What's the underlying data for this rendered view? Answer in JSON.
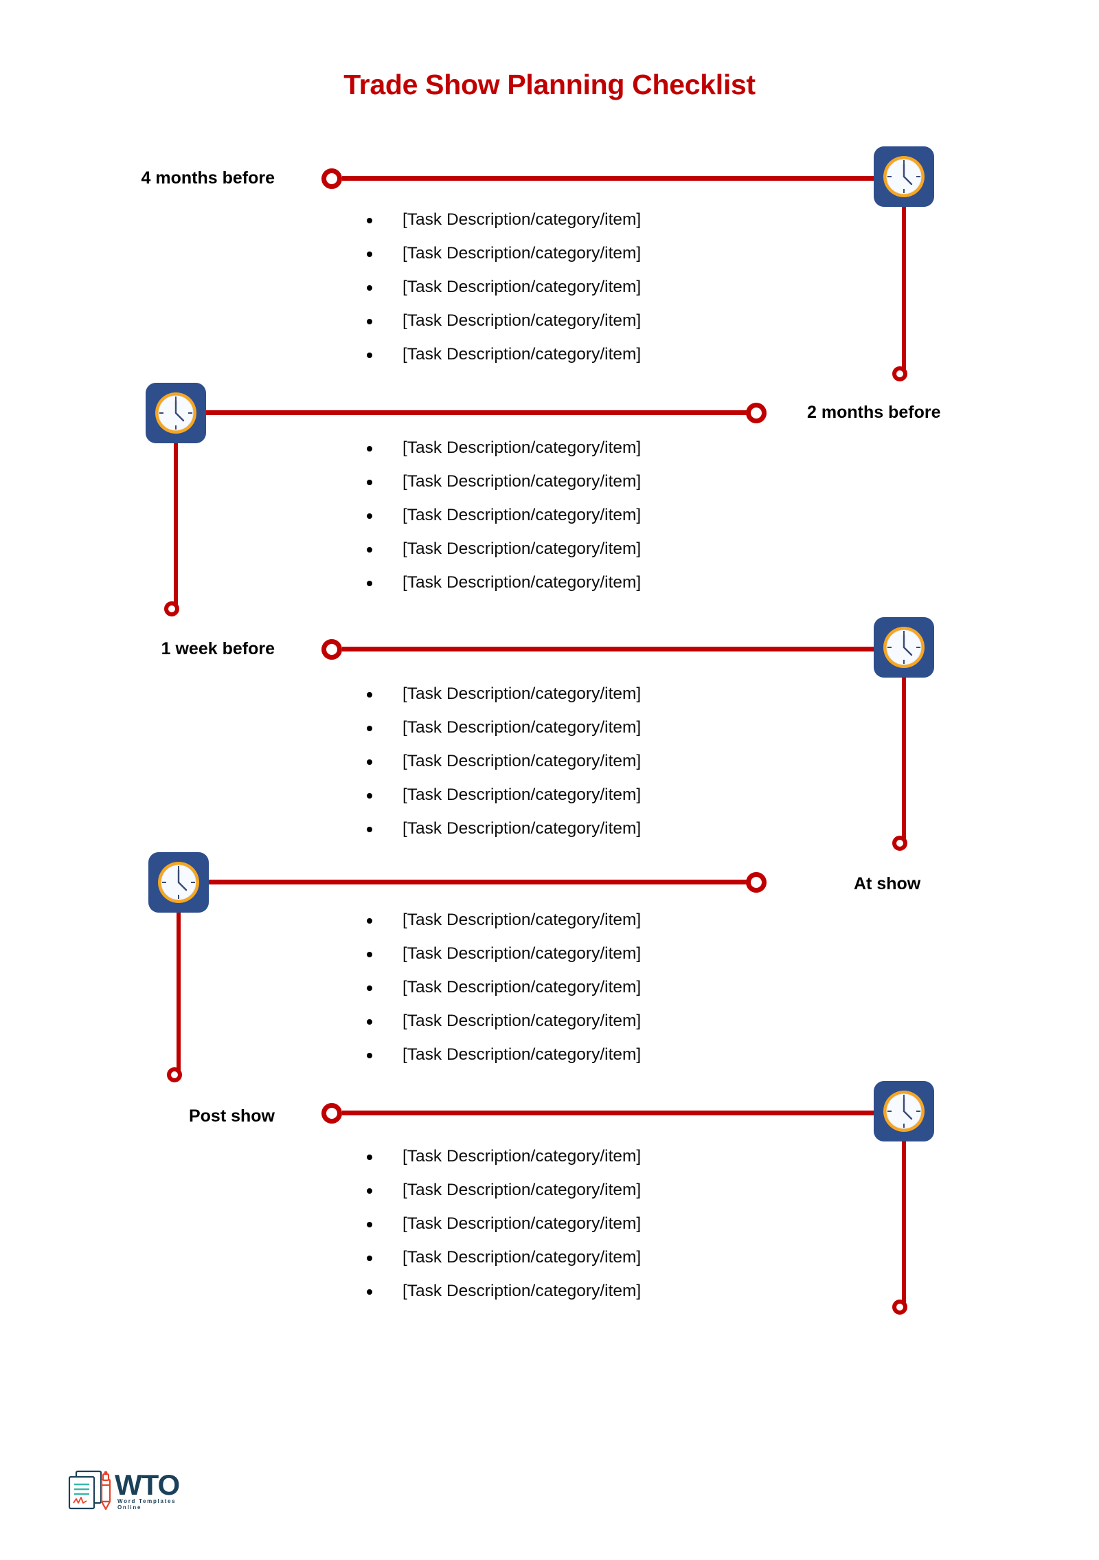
{
  "document": {
    "title": "Trade Show Planning Checklist",
    "title_color": "#C00000",
    "accent_color": "#C00000",
    "icon_box_color": "#2F4E8C",
    "icon_bezel_color": "#F5A623",
    "background": "#FFFFFF"
  },
  "timeline": {
    "sections": [
      {
        "label": "4 months before",
        "label_side": "left",
        "icon_side": "right",
        "icon": "clock-icon",
        "tasks": [
          "[Task Description/category/item]",
          "[Task Description/category/item]",
          "[Task Description/category/item]",
          "[Task Description/category/item]",
          "[Task Description/category/item]"
        ]
      },
      {
        "label": "2 months before",
        "label_side": "right",
        "icon_side": "left",
        "icon": "clock-icon",
        "tasks": [
          "[Task Description/category/item]",
          "[Task Description/category/item]",
          "[Task Description/category/item]",
          "[Task Description/category/item]",
          "[Task Description/category/item]"
        ]
      },
      {
        "label": "1 week before",
        "label_side": "left",
        "icon_side": "right",
        "icon": "clock-icon",
        "tasks": [
          "[Task Description/category/item]",
          "[Task Description/category/item]",
          "[Task Description/category/item]",
          "[Task Description/category/item]",
          "[Task Description/category/item]"
        ]
      },
      {
        "label": "At show",
        "label_side": "right",
        "icon_side": "left",
        "icon": "clock-icon",
        "tasks": [
          "[Task Description/category/item]",
          "[Task Description/category/item]",
          "[Task Description/category/item]",
          "[Task Description/category/item]",
          "[Task Description/category/item]"
        ]
      },
      {
        "label": "Post show",
        "label_side": "left",
        "icon_side": "right",
        "icon": "clock-icon",
        "tasks": [
          "[Task Description/category/item]",
          "[Task Description/category/item]",
          "[Task Description/category/item]",
          "[Task Description/category/item]",
          "[Task Description/category/item]"
        ]
      }
    ]
  },
  "logo": {
    "wordmark": "WTO",
    "tagline": "Word Templates Online",
    "document_icon": "document-icon",
    "pen_icon": "pen-icon"
  }
}
